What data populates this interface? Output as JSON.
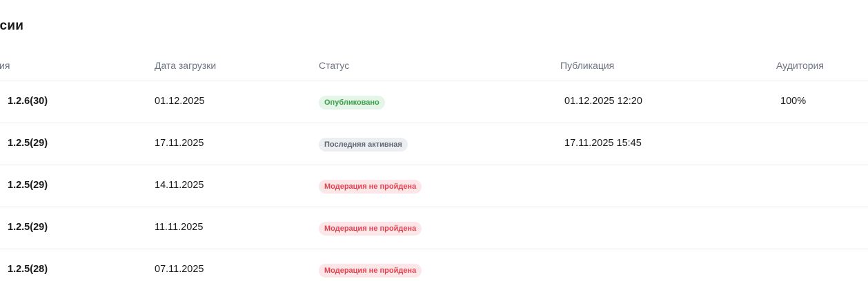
{
  "section": {
    "title": "осии"
  },
  "table": {
    "headers": {
      "version": "сия",
      "upload_date": "Дата загрузки",
      "status": "Статус",
      "publication": "Публикация",
      "audience": "Аудитория"
    },
    "rows": [
      {
        "version": "1.2.6(30)",
        "upload_date": "01.12.2025",
        "status": "Опубликовано",
        "status_kind": "published",
        "publication": "01.12.2025 12:20",
        "audience": "100%"
      },
      {
        "version": "1.2.5(29)",
        "upload_date": "17.11.2025",
        "status": "Последняя активная",
        "status_kind": "last-active",
        "publication": "17.11.2025 15:45",
        "audience": ""
      },
      {
        "version": "1.2.5(29)",
        "upload_date": "14.11.2025",
        "status": "Модерация не пройдена",
        "status_kind": "rejected",
        "publication": "",
        "audience": ""
      },
      {
        "version": "1.2.5(29)",
        "upload_date": "11.11.2025",
        "status": "Модерация не пройдена",
        "status_kind": "rejected",
        "publication": "",
        "audience": ""
      },
      {
        "version": "1.2.5(28)",
        "upload_date": "07.11.2025",
        "status": "Модерация не пройдена",
        "status_kind": "rejected",
        "publication": "",
        "audience": ""
      }
    ]
  },
  "colors": {
    "published_bg": "#e5f6e8",
    "published_text": "#3aa04a",
    "last_active_bg": "#eceef2",
    "last_active_text": "#5f6673",
    "rejected_bg": "#fde6e8",
    "rejected_text": "#e2424f"
  }
}
